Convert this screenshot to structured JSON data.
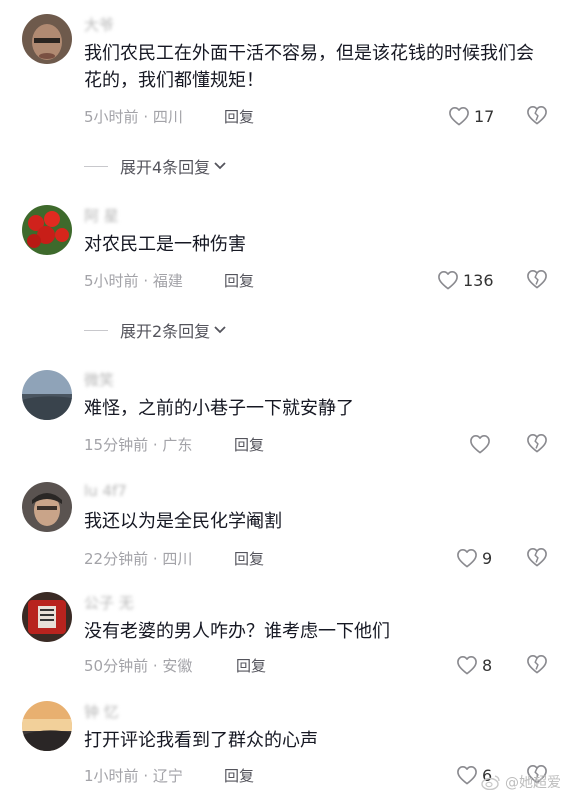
{
  "comments": [
    {
      "username": "大爷",
      "content": "我们农民工在外面干活不容易，但是该花钱的时候我们会花的，我们都懂规矩！",
      "time": "5小时前",
      "location": "四川",
      "reply_label": "回复",
      "likes": "17",
      "expand_label": "展开4条回复"
    },
    {
      "username": "阿 星",
      "content": "对农民工是一种伤害",
      "time": "5小时前",
      "location": "福建",
      "reply_label": "回复",
      "likes": "136",
      "expand_label": "展开2条回复"
    },
    {
      "username": "微笑",
      "content": "难怪，之前的小巷子一下就安静了",
      "time": "15分钟前",
      "location": "广东",
      "reply_label": "回复",
      "likes": ""
    },
    {
      "username": "lu 4f7",
      "content": "我还以为是全民化学阉割",
      "time": "22分钟前",
      "location": "四川",
      "reply_label": "回复",
      "likes": "9"
    },
    {
      "username": "公子 无",
      "content": "没有老婆的男人咋办？谁考虑一下他们",
      "time": "50分钟前",
      "location": "安徽",
      "reply_label": "回复",
      "likes": "8"
    },
    {
      "username": "钟 忆",
      "content": "打开评论我看到了群众的心声",
      "time": "1小时前",
      "location": "辽宁",
      "reply_label": "回复",
      "likes": "6"
    }
  ],
  "separator": " · ",
  "watermark": "@她超爱",
  "icons": {
    "like": "heart-outline-icon",
    "dislike": "broken-heart-icon",
    "expand": "chevron-down-icon",
    "watermark": "weibo-logo-icon"
  }
}
